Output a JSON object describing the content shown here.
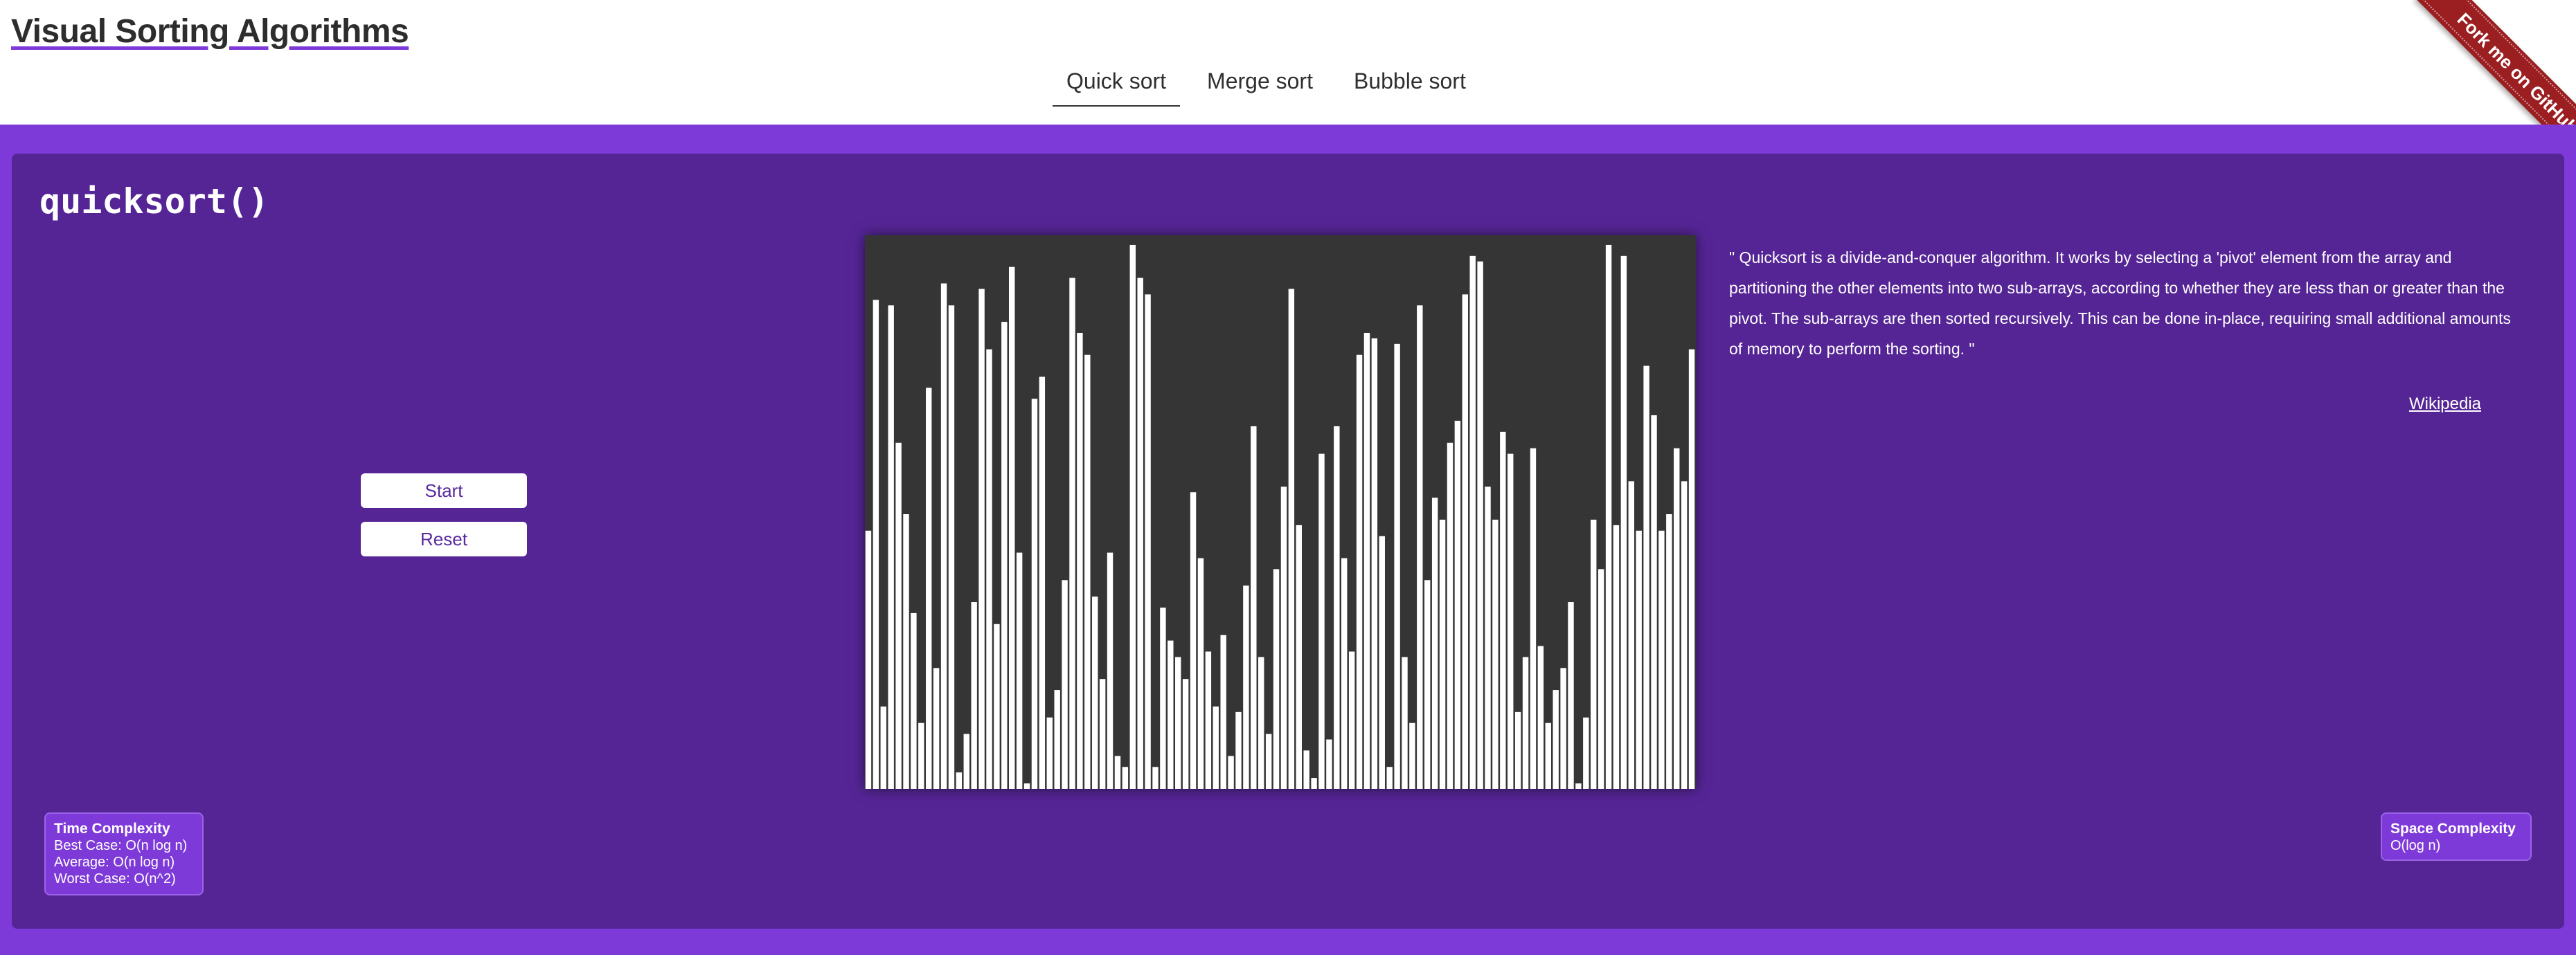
{
  "header": {
    "title": "Visual Sorting Algorithms",
    "tabs": [
      {
        "label": "Quick sort",
        "active": true
      },
      {
        "label": "Merge sort",
        "active": false
      },
      {
        "label": "Bubble sort",
        "active": false
      }
    ],
    "ribbon": "Fork me on GitHub"
  },
  "main": {
    "algorithm": "quicksort()",
    "controls": {
      "start": "Start",
      "reset": "Reset"
    },
    "description": "\"  Quicksort is a divide-and-conquer algorithm. It works by selecting a 'pivot' element from the array and partitioning the other elements into two sub-arrays, according to whether they are less than or greater than the pivot. The sub-arrays are then sorted recursively. This can be done in-place, requiring small additional amounts of memory to perform the sorting.  \"",
    "link": "Wikipedia",
    "time_complexity": {
      "title": "Time Complexity",
      "best": "Best Case: O(n log n)",
      "average": "Average: O(n log n)",
      "worst": "Worst Case: O(n^2)"
    },
    "space_complexity": {
      "title": "Space Complexity",
      "value": "O(log n)"
    }
  },
  "colors": {
    "accent": "#7e3ad8",
    "panel": "#552596",
    "canvas": "#353535",
    "bar": "#ffffff"
  },
  "chart_data": {
    "type": "bar",
    "values": [
      0.47,
      0.89,
      0.15,
      0.88,
      0.63,
      0.5,
      0.32,
      0.12,
      0.73,
      0.22,
      0.92,
      0.88,
      0.03,
      0.1,
      0.34,
      0.91,
      0.8,
      0.3,
      0.85,
      0.95,
      0.43,
      0.01,
      0.71,
      0.75,
      0.13,
      0.18,
      0.38,
      0.93,
      0.83,
      0.79,
      0.35,
      0.2,
      0.43,
      0.06,
      0.04,
      0.99,
      0.93,
      0.9,
      0.04,
      0.33,
      0.27,
      0.24,
      0.2,
      0.54,
      0.42,
      0.25,
      0.15,
      0.28,
      0.06,
      0.14,
      0.37,
      0.66,
      0.24,
      0.1,
      0.4,
      0.55,
      0.91,
      0.48,
      0.07,
      0.02,
      0.61,
      0.09,
      0.66,
      0.42,
      0.25,
      0.79,
      0.83,
      0.82,
      0.46,
      0.04,
      0.81,
      0.24,
      0.12,
      0.88,
      0.38,
      0.53,
      0.49,
      0.63,
      0.67,
      0.9,
      0.97,
      0.96,
      0.55,
      0.49,
      0.65,
      0.61,
      0.14,
      0.24,
      0.62,
      0.26,
      0.12,
      0.18,
      0.22,
      0.34,
      0.01,
      0.13,
      0.49,
      0.4,
      0.99,
      0.48,
      0.97,
      0.56,
      0.47,
      0.77,
      0.68,
      0.47,
      0.5,
      0.62,
      0.56,
      0.8
    ]
  }
}
